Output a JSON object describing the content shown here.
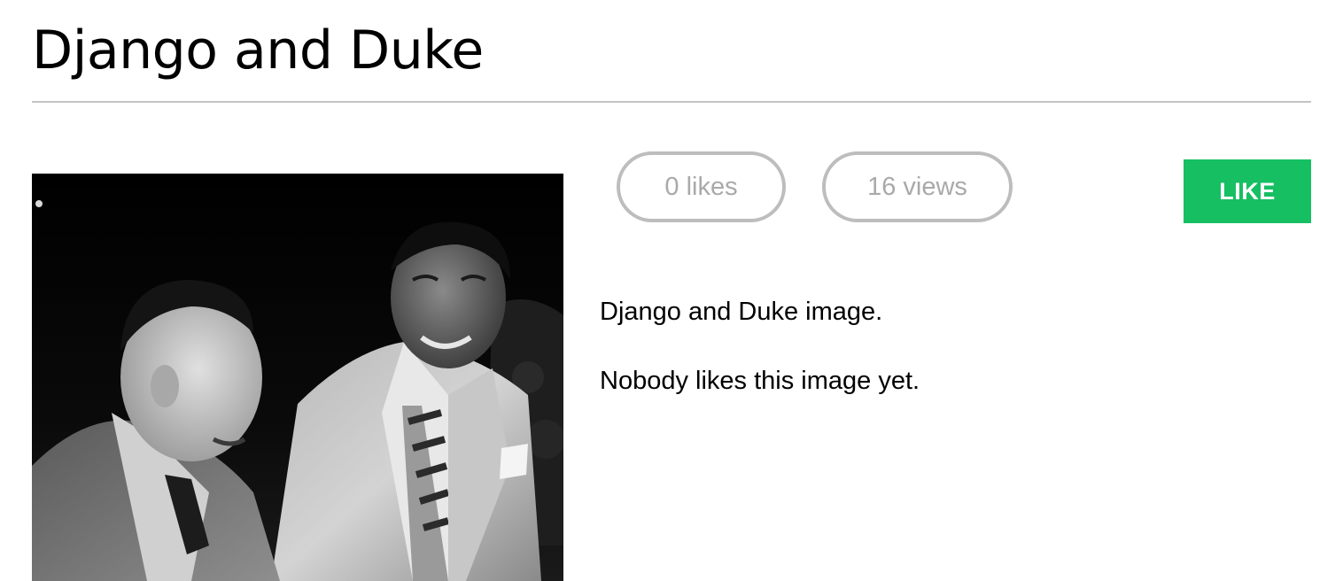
{
  "page": {
    "title": "Django and Duke"
  },
  "image": {
    "alt": "Django and Duke image."
  },
  "stats": {
    "likes_label": "0 likes",
    "views_label": "16 views"
  },
  "actions": {
    "like_label": "LIKE"
  },
  "details": {
    "description": "Django and Duke image.",
    "likes_message": "Nobody likes this image yet."
  },
  "colors": {
    "like_button": "#17bf63",
    "pill_border": "#bdbdbd",
    "pill_text": "#a9a9a9",
    "divider": "#c4c4c4"
  }
}
